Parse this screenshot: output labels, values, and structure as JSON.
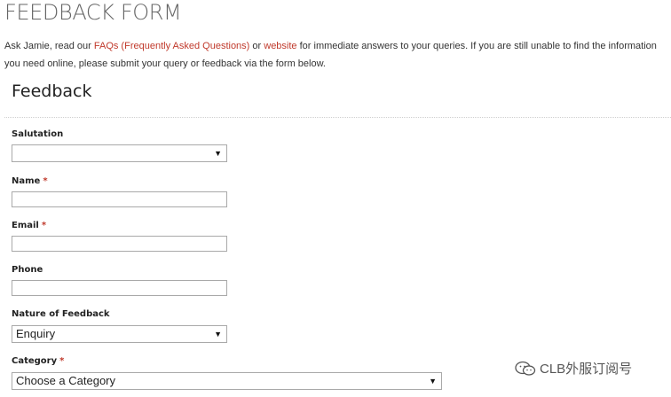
{
  "page": {
    "title": "FEEDBACK FORM",
    "intro": {
      "part1": "Ask Jamie, read our ",
      "faq_link": "FAQs (Frequently Asked Questions)",
      "part2": " or ",
      "website_link": "website",
      "part3": " for immediate answers to your queries. If you are still unable to find the information you need online, please submit your query or feedback via the form below."
    }
  },
  "form": {
    "heading": "Feedback",
    "required_mark": "*",
    "salutation": {
      "label": "Salutation",
      "value": ""
    },
    "name": {
      "label": "Name",
      "value": ""
    },
    "email": {
      "label": "Email",
      "value": ""
    },
    "phone": {
      "label": "Phone",
      "value": ""
    },
    "nature": {
      "label": "Nature of Feedback",
      "value": "Enquiry"
    },
    "category": {
      "label": "Category",
      "value": "Choose a Category"
    }
  },
  "watermark": {
    "text": "CLB外服订阅号",
    "icon": "wechat-icon"
  },
  "colors": {
    "link": "#c0392b",
    "required": "#c0392b",
    "title": "#666666"
  }
}
